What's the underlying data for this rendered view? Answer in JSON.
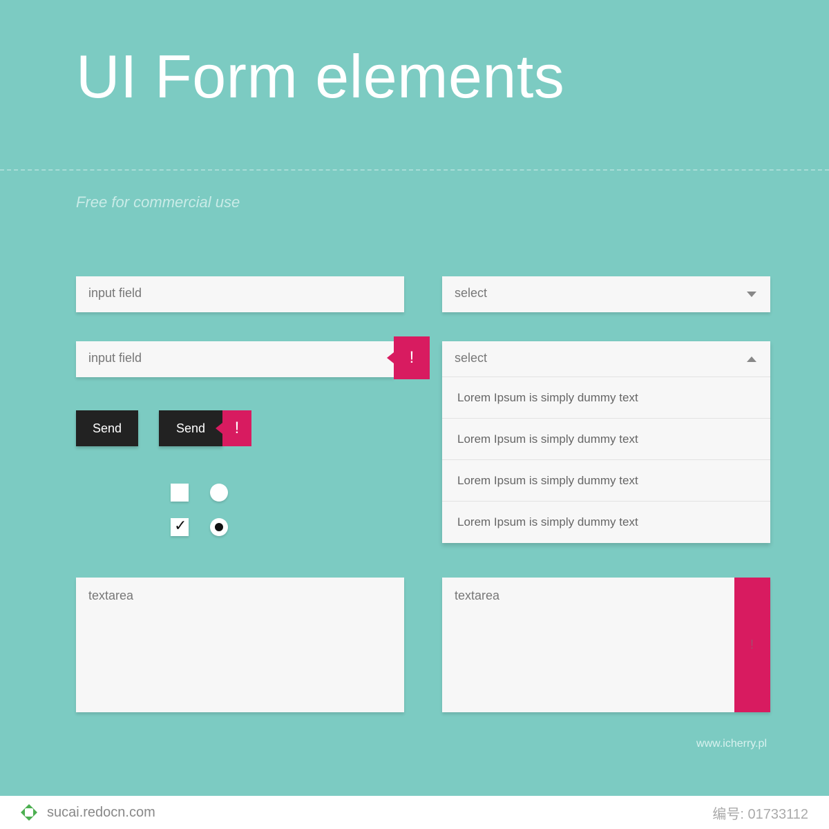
{
  "title": "UI Form elements",
  "subtitle": "Free for commercial use",
  "left": {
    "input1_placeholder": "input field",
    "input2_placeholder": "input field",
    "error_glyph": "!",
    "btn1_label": "Send",
    "btn2_label": "Send",
    "textarea_placeholder": "textarea"
  },
  "right": {
    "select_closed_label": "select",
    "select_open_label": "select",
    "options": [
      "Lorem Ipsum is simply dummy text",
      "Lorem Ipsum is simply dummy text",
      "Lorem Ipsum is simply dummy text",
      "Lorem Ipsum is simply dummy text"
    ],
    "textarea_placeholder": "textarea",
    "textarea_error_glyph": "!"
  },
  "footer_link": "www.icherry.pl",
  "meta": {
    "site": "sucai.redocn.com",
    "id_label": "编号",
    "id_value": "01733112"
  },
  "colors": {
    "bg": "#7ccbc2",
    "accent": "#d81b60",
    "dark": "#222222",
    "panel": "#f7f7f7"
  }
}
